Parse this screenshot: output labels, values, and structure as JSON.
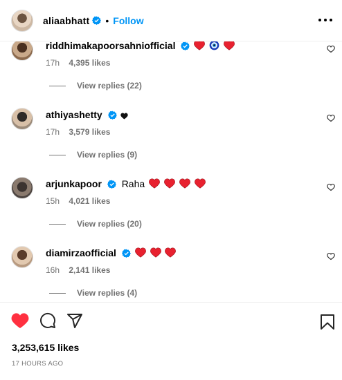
{
  "header": {
    "username": "aliaabhatt",
    "separator": "•",
    "follow_label": "Follow",
    "more_icon": "more-horizontal-icon"
  },
  "comments": [
    {
      "username": "riddhimakapoorsahniofficial",
      "verified": true,
      "text": "",
      "emojis": [
        "red-heart",
        "nazar-amulet",
        "red-heart"
      ],
      "time": "17h",
      "likes": "4,395 likes",
      "replies": "View replies (22)"
    },
    {
      "username": "athiyashetty",
      "verified": true,
      "text": "",
      "emojis": [
        "black-heart"
      ],
      "time": "17h",
      "likes": "3,579 likes",
      "replies": "View replies (9)"
    },
    {
      "username": "arjunkapoor",
      "verified": true,
      "text": "Raha",
      "emojis": [
        "red-heart",
        "red-heart",
        "red-heart",
        "red-heart"
      ],
      "time": "15h",
      "likes": "4,021 likes",
      "replies": "View replies (20)"
    },
    {
      "username": "diamirzaofficial",
      "verified": true,
      "text": "",
      "emojis": [
        "red-heart",
        "red-heart",
        "red-heart"
      ],
      "time": "16h",
      "likes": "2,141 likes",
      "replies": "View replies (4)"
    }
  ],
  "footer": {
    "likes": "3,253,615 likes",
    "time_ago": "17 HOURS AGO",
    "liked": true
  },
  "colors": {
    "accent": "#0095f6",
    "like_red": "#ff3040",
    "muted": "#737373",
    "verified_blue": "#0095f6"
  }
}
